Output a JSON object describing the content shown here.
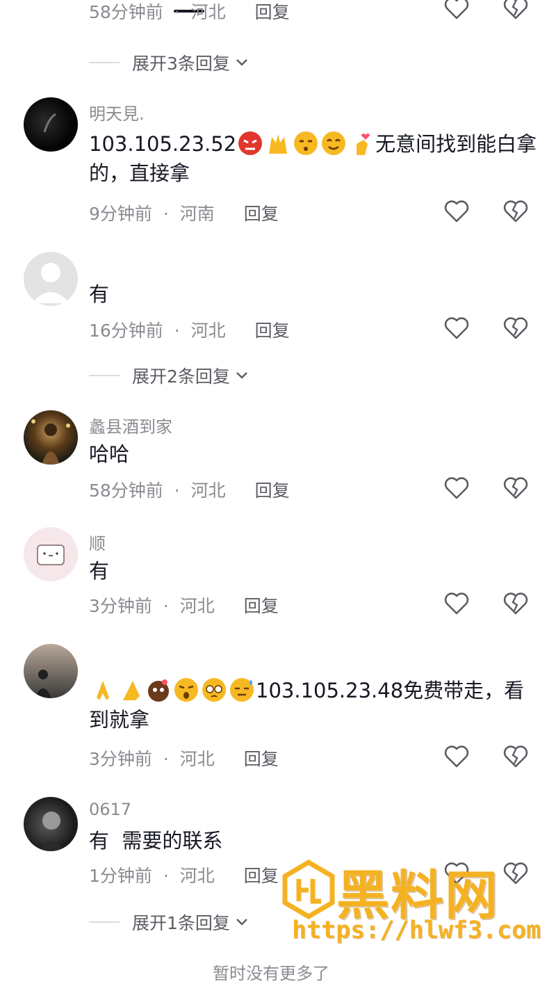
{
  "top_partial": {
    "time": "58分钟前",
    "location": "河北",
    "reply": "回复"
  },
  "expand_1": "展开3条回复",
  "comments": [
    {
      "name": "明天見.",
      "text": "103.105.23.52",
      "text_after": "无意间找到能白拿的，直接拿",
      "time": "9分钟前",
      "location": "河南",
      "reply": "回复"
    },
    {
      "name": "",
      "text": "有",
      "time": "16分钟前",
      "location": "河北",
      "reply": "回复"
    },
    {
      "name": "蠡县酒到家",
      "text": "哈哈",
      "time": "58分钟前",
      "location": "河北",
      "reply": "回复"
    },
    {
      "name": "顺",
      "text": "有",
      "time": "3分钟前",
      "location": "河北",
      "reply": "回复"
    },
    {
      "name": "",
      "text_before": "",
      "text": "103.105.23.48免费带走，看到就拿",
      "time": "3分钟前",
      "location": "河北",
      "reply": "回复"
    },
    {
      "name": "0617",
      "text": "有  需要的联系",
      "time": "1分钟前",
      "location": "河北",
      "reply": "回复"
    }
  ],
  "expand_2": "展开2条回复",
  "expand_3": "展开1条回复",
  "bottom_partial": "暂时没有更多了",
  "separator": "·",
  "watermark": {
    "title": "黑料网",
    "url": "https://hlwf3.com"
  },
  "icons": {
    "like": "heart-outline-icon",
    "dislike": "broken-heart-icon",
    "chevron": "chevron-down-icon"
  },
  "colors": {
    "meta": "#8a8b91",
    "text": "#161823",
    "watermark": "#f4b223"
  }
}
